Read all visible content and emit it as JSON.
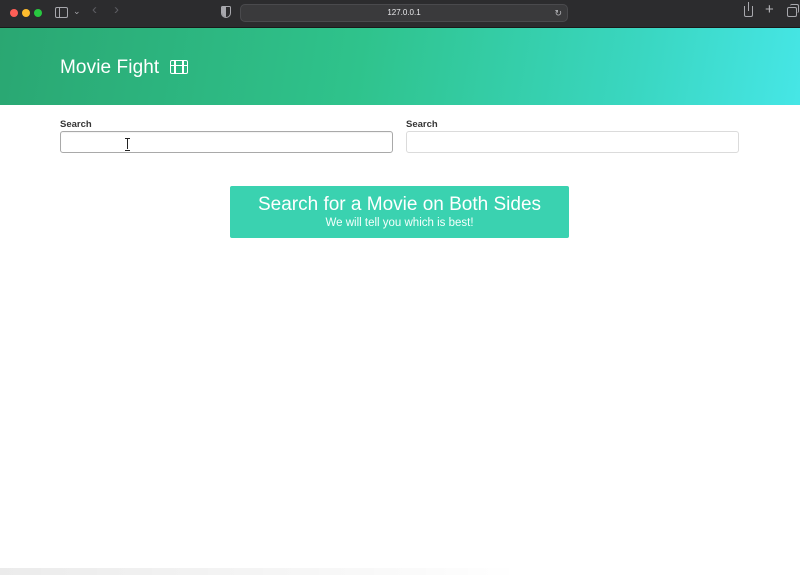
{
  "browser": {
    "url": "127.0.0.1",
    "icons": [
      "sidebar-toggle-icon",
      "chevron-down-icon",
      "back-arrow-icon",
      "forward-arrow-icon",
      "privacy-shield-icon",
      "reload-icon",
      "share-icon",
      "new-tab-icon",
      "tab-overview-icon"
    ]
  },
  "header": {
    "title": "Movie Fight",
    "icon": "film-icon"
  },
  "search": {
    "left": {
      "label": "Search",
      "value": "",
      "placeholder": ""
    },
    "right": {
      "label": "Search",
      "value": "",
      "placeholder": ""
    }
  },
  "cta": {
    "title": "Search for a Movie on Both Sides",
    "subtitle": "We will tell you which is best!"
  },
  "colors": {
    "hero_gradient_start": "#2aa772",
    "hero_gradient_end": "#46e6e6",
    "cta_background": "#3ad2b0"
  }
}
